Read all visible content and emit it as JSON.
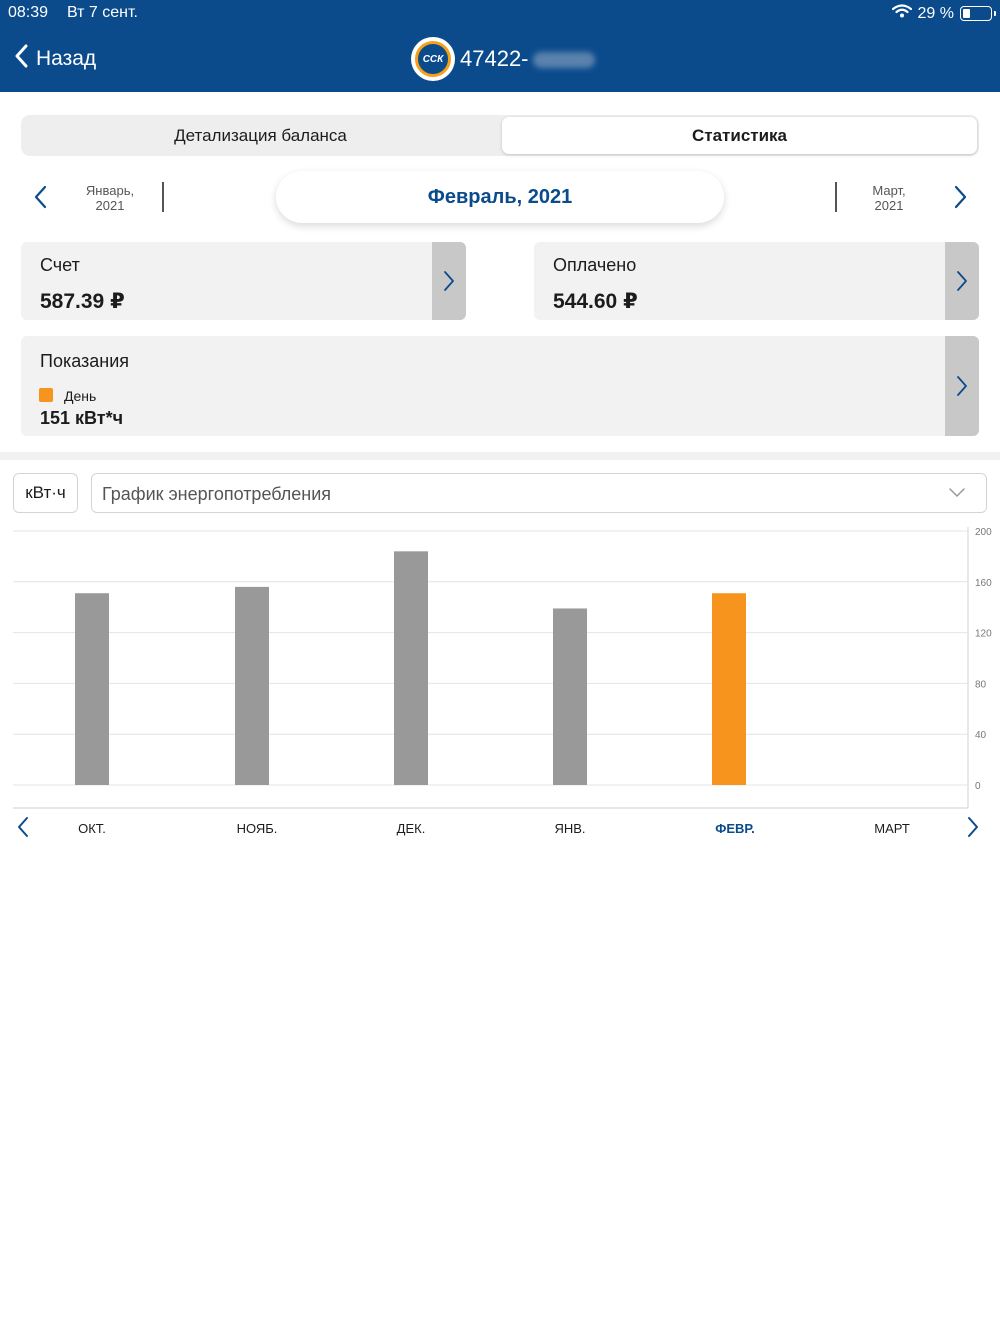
{
  "status": {
    "time": "08:39",
    "date": "Вт 7 сент.",
    "battery": "29 %",
    "battery_level": 0.29
  },
  "nav": {
    "back_label": "Назад",
    "logo_text": "ССК",
    "account": "47422-"
  },
  "tabs": [
    {
      "label": "Детализация баланса",
      "active": false
    },
    {
      "label": "Статистика",
      "active": true
    }
  ],
  "period": {
    "prev_month": "Январь,",
    "prev_year": "2021",
    "current": "Февраль, 2021",
    "next_month": "Март,",
    "next_year": "2021"
  },
  "cards": {
    "invoice": {
      "label": "Счет",
      "value": "587.39 ₽"
    },
    "paid": {
      "label": "Оплачено",
      "value": "544.60 ₽"
    },
    "readings": {
      "label": "Показания",
      "tariff": "День",
      "value": "151 кВт*ч"
    }
  },
  "chart_controls": {
    "unit": "кВт·ч",
    "chart_type": "График энергопотребления"
  },
  "colors": {
    "header": "#0b4b8c",
    "accent": "#f7941d",
    "bar": "#999999"
  },
  "chart_data": {
    "type": "bar",
    "categories": [
      "ОКТ.",
      "НОЯБ.",
      "ДЕК.",
      "ЯНВ.",
      "ФЕВР.",
      "МАРТ"
    ],
    "values": [
      151,
      156,
      184,
      139,
      151,
      null
    ],
    "highlight_index": 4,
    "ylim": [
      0,
      200
    ],
    "yticks": [
      0,
      40,
      80,
      120,
      160,
      200
    ],
    "y_axis_position": "right",
    "grid": true,
    "title": "",
    "xlabel": "",
    "ylabel": ""
  }
}
